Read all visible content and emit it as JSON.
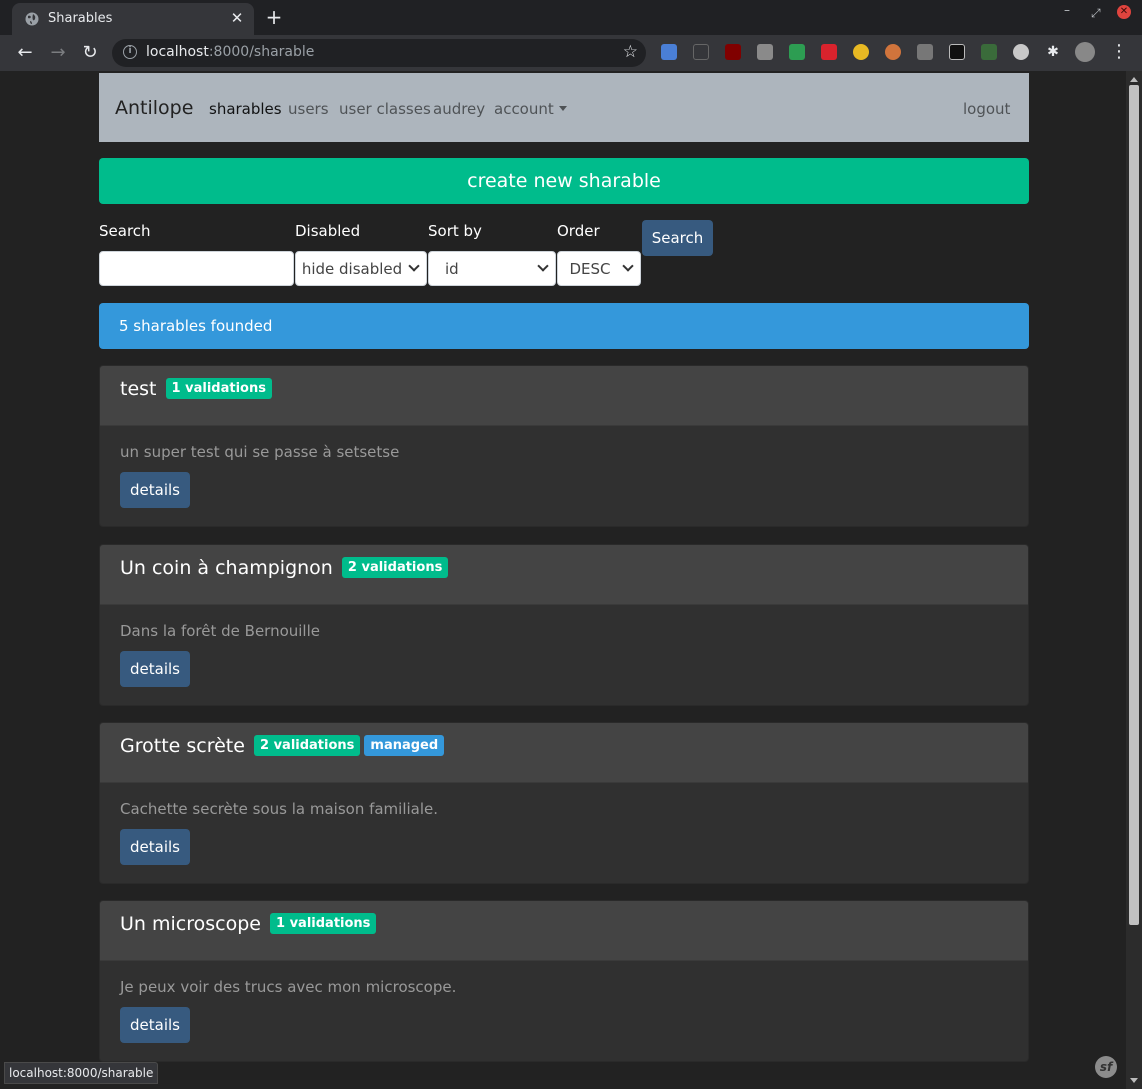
{
  "browser": {
    "tab_title": "Sharables",
    "url_host": "localhost",
    "url_rest": ":8000/sharable",
    "status_url": "localhost:8000/sharable"
  },
  "navbar": {
    "brand": "Antilope",
    "links": [
      "sharables",
      "users",
      "user classes",
      "audrey",
      "account"
    ],
    "logout": "logout"
  },
  "create_button": "create new sharable",
  "filters": {
    "search_label": "Search",
    "search_value": "",
    "disabled_label": "Disabled",
    "disabled_value": "hide disabled",
    "sort_label": "Sort by",
    "sort_value": "id",
    "order_label": "Order",
    "order_value": "DESC",
    "search_button": "Search"
  },
  "alert": "5 sharables founded",
  "sharables": [
    {
      "title": "test",
      "badges": [
        "1 validations"
      ],
      "description": "un super test qui se passe à setsetse",
      "button": "details"
    },
    {
      "title": "Un coin à champignon",
      "badges": [
        "2 validations"
      ],
      "description": "Dans la forêt de Bernouille",
      "button": "details"
    },
    {
      "title": "Grotte scrète",
      "badges": [
        "2 validations"
      ],
      "managed_badge": "managed",
      "description": "Cachette secrète sous la maison familiale.",
      "button": "details"
    },
    {
      "title": "Un microscope",
      "badges": [
        "1 validations"
      ],
      "description": "Je peux voir des trucs avec mon microscope.",
      "button": "details"
    }
  ],
  "colors": {
    "navbar": "#adb5bd",
    "success": "#00bc8c",
    "info": "#3498db",
    "primary": "#375a7f",
    "background": "#222222"
  }
}
